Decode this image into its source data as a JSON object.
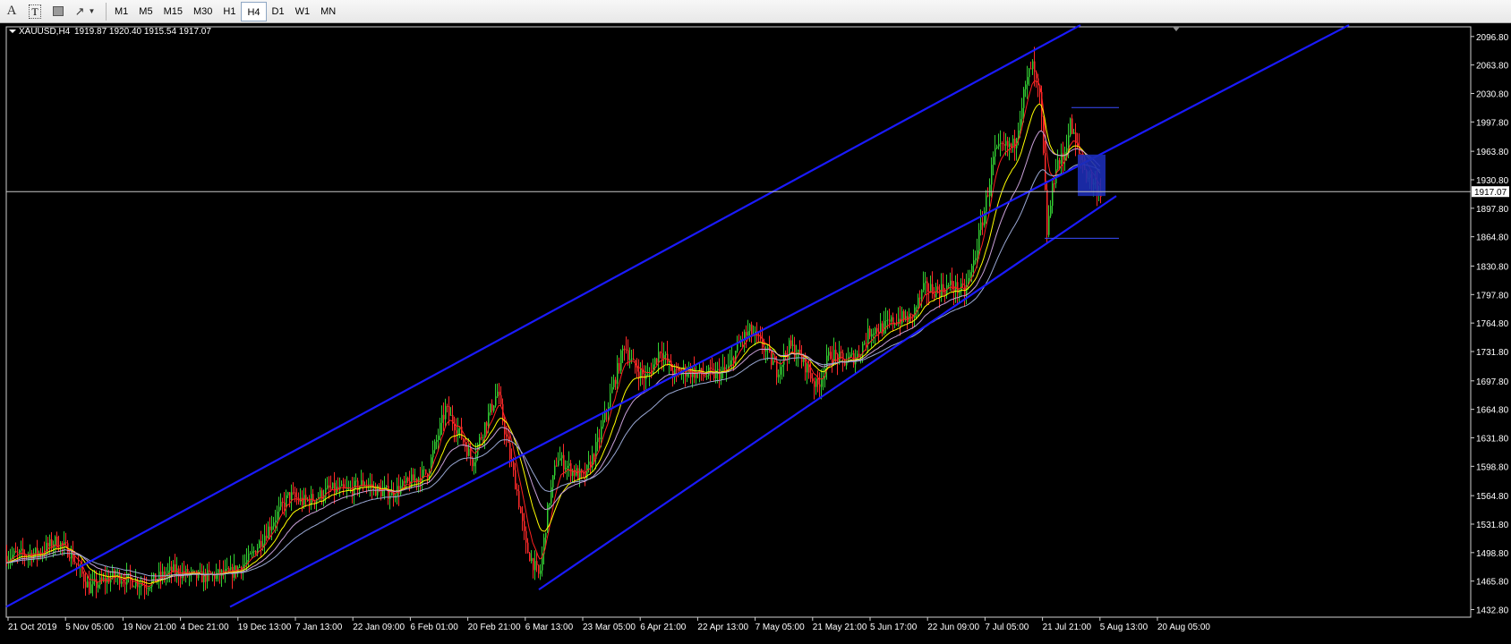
{
  "toolbar": {
    "tools": [
      {
        "name": "text-tool-icon",
        "glyph": "A"
      },
      {
        "name": "text-label-tool-icon",
        "glyph": "T"
      },
      {
        "name": "rectangle-tool-icon",
        "glyph": ""
      },
      {
        "name": "arrows-tool-icon",
        "glyph": "↗"
      }
    ],
    "timeframes": [
      "M1",
      "M5",
      "M15",
      "M30",
      "H1",
      "H4",
      "D1",
      "W1",
      "MN"
    ],
    "active_timeframe": "H4"
  },
  "chart_info": {
    "symbol": "XAUUSD,H4",
    "quote": "1919.87 1920.40 1915.54 1917.07"
  },
  "chart_data": {
    "type": "candlestick",
    "title": "XAUUSD,H4",
    "ylim": [
      1424.0,
      2108.0
    ],
    "y_ticks": [
      "2096.80",
      "2063.80",
      "2030.80",
      "1997.80",
      "1963.80",
      "1930.80",
      "1897.80",
      "1864.80",
      "1830.80",
      "1797.80",
      "1764.80",
      "1731.80",
      "1697.80",
      "1664.80",
      "1631.80",
      "1598.80",
      "1564.80",
      "1531.80",
      "1498.80",
      "1465.80",
      "1432.80"
    ],
    "x_ticks": [
      "21 Oct 2019",
      "5 Nov 05:00",
      "19 Nov 21:00",
      "4 Dec 21:00",
      "19 Dec 13:00",
      "7 Jan 13:00",
      "22 Jan 09:00",
      "6 Feb 01:00",
      "20 Feb 21:00",
      "6 Mar 13:00",
      "23 Mar 05:00",
      "6 Apr 21:00",
      "22 Apr 13:00",
      "7 May 05:00",
      "21 May 21:00",
      "5 Jun 17:00",
      "22 Jun 09:00",
      "7 Jul 05:00",
      "21 Jul 21:00",
      "5 Aug 13:00",
      "20 Aug 05:00"
    ],
    "current_price": "1917.07",
    "price_path": [
      [
        0,
        1495
      ],
      [
        35,
        1498
      ],
      [
        55,
        1512
      ],
      [
        70,
        1500
      ],
      [
        92,
        1458
      ],
      [
        120,
        1472
      ],
      [
        155,
        1462
      ],
      [
        185,
        1478
      ],
      [
        215,
        1470
      ],
      [
        250,
        1475
      ],
      [
        270,
        1490
      ],
      [
        300,
        1540
      ],
      [
        315,
        1565
      ],
      [
        330,
        1558
      ],
      [
        345,
        1562
      ],
      [
        360,
        1572
      ],
      [
        380,
        1570
      ],
      [
        400,
        1580
      ],
      [
        415,
        1570
      ],
      [
        430,
        1568
      ],
      [
        450,
        1580
      ],
      [
        470,
        1592
      ],
      [
        490,
        1665
      ],
      [
        505,
        1640
      ],
      [
        520,
        1605
      ],
      [
        535,
        1650
      ],
      [
        548,
        1685
      ],
      [
        560,
        1620
      ],
      [
        570,
        1570
      ],
      [
        580,
        1505
      ],
      [
        595,
        1470
      ],
      [
        605,
        1555
      ],
      [
        615,
        1610
      ],
      [
        630,
        1595
      ],
      [
        645,
        1585
      ],
      [
        660,
        1625
      ],
      [
        670,
        1665
      ],
      [
        690,
        1740
      ],
      [
        700,
        1715
      ],
      [
        715,
        1700
      ],
      [
        730,
        1735
      ],
      [
        745,
        1705
      ],
      [
        760,
        1710
      ],
      [
        775,
        1705
      ],
      [
        790,
        1705
      ],
      [
        805,
        1710
      ],
      [
        820,
        1745
      ],
      [
        830,
        1755
      ],
      [
        845,
        1738
      ],
      [
        860,
        1710
      ],
      [
        875,
        1738
      ],
      [
        890,
        1720
      ],
      [
        905,
        1690
      ],
      [
        920,
        1730
      ],
      [
        935,
        1720
      ],
      [
        950,
        1727
      ],
      [
        965,
        1757
      ],
      [
        980,
        1760
      ],
      [
        995,
        1770
      ],
      [
        1010,
        1770
      ],
      [
        1025,
        1805
      ],
      [
        1040,
        1803
      ],
      [
        1055,
        1808
      ],
      [
        1070,
        1800
      ],
      [
        1080,
        1835
      ],
      [
        1092,
        1895
      ],
      [
        1103,
        1960
      ],
      [
        1115,
        1968
      ],
      [
        1125,
        1970
      ],
      [
        1135,
        2025
      ],
      [
        1145,
        2065
      ],
      [
        1155,
        2020
      ],
      [
        1162,
        1870
      ],
      [
        1172,
        1950
      ],
      [
        1180,
        1955
      ],
      [
        1188,
        1995
      ],
      [
        1195,
        1968
      ],
      [
        1205,
        1940
      ],
      [
        1215,
        1925
      ],
      [
        1222,
        1917
      ]
    ],
    "moving_averages": [
      {
        "color": "#ff2020",
        "smoothing": 0.22
      },
      {
        "color": "#ffff00",
        "smoothing": 0.1
      },
      {
        "color": "#c9a0d8",
        "smoothing": 0.06
      },
      {
        "color": "#9aa8d4",
        "smoothing": 0.035
      }
    ],
    "channel": {
      "color": "#1a1aff",
      "upper": [
        [
          0,
          1436
        ],
        [
          1200,
          2110
        ]
      ],
      "lower": [
        [
          250,
          1436
        ],
        [
          1500,
          2110
        ]
      ],
      "mid": [
        [
          595,
          1456
        ],
        [
          1240,
          1912
        ]
      ]
    },
    "levels": [
      {
        "price": 2014.5,
        "x_from": 1190,
        "x_to": 1243,
        "color": "#3a4cff"
      },
      {
        "price": 1863.0,
        "x_from": 1160,
        "x_to": 1243,
        "color": "#3a4cff"
      }
    ],
    "highlight_box": {
      "x_from": 1197,
      "x_to": 1228,
      "price_top": 1960,
      "price_bottom": 1912,
      "color": "#1c2db5"
    }
  }
}
